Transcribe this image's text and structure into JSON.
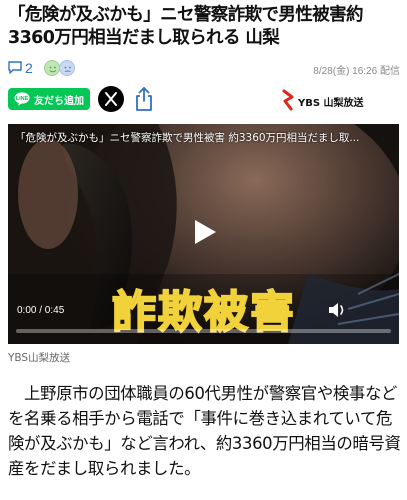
{
  "article": {
    "headline": "「危険が及ぶかも」ニセ警察詐欺で男性被害約3360万円相当だまし取られる 山梨",
    "comment_count": "2",
    "datetime": "8/28(金) 16:26 配信",
    "source_label": "YBS山梨放送",
    "body": "上野原市の団体職員の60代男性が警察官や検事などを名乗る相手から電話で「事件に巻き込まれていて危険が及ぶかも」など言われ、約3360万円相当の暗号資産をだまし取られました。"
  },
  "share": {
    "line_label": "友だち追加",
    "x_icon": "x-logo-icon",
    "share_icon": "share-icon"
  },
  "publisher": {
    "name": "YBS 山梨放送",
    "color": "#e0261b"
  },
  "video": {
    "title": "「危険が及ぶかも」ニセ警察詐欺で男性被害 約3360万円相当だまし取...",
    "banner_text": "詐欺被害",
    "time": "0:00 / 0:45",
    "progress": 0.0
  },
  "colors": {
    "line_green": "#06c755",
    "link_blue": "#2f6fc7",
    "banner_red": "#e02a1c",
    "banner_stroke": "#f2d23a"
  }
}
